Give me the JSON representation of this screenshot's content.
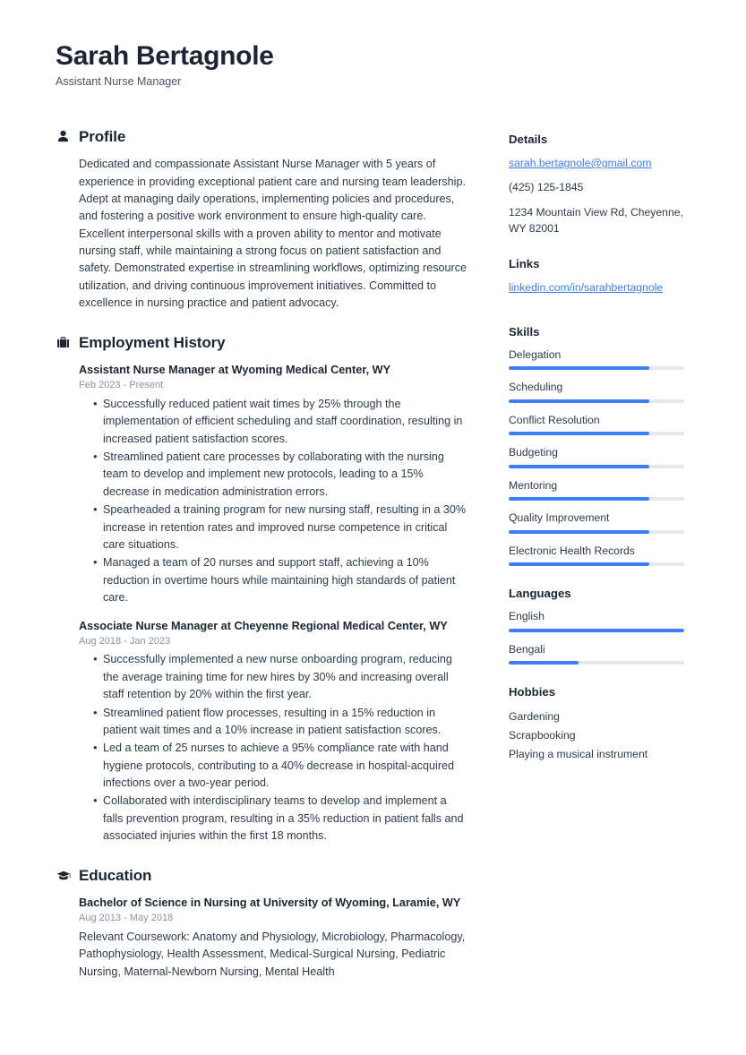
{
  "accent_color": "#3d7ef7",
  "text_color": "#2d3b4d",
  "heading_color": "#1b2533",
  "muted_color": "#8a939f",
  "track_color": "#e6e8ea",
  "header": {
    "full_name": "Sarah Bertagnole",
    "job_title": "Assistant Nurse Manager"
  },
  "sections": {
    "profile": {
      "title": "Profile",
      "icon": "person-icon",
      "text": "Dedicated and compassionate Assistant Nurse Manager with 5 years of experience in providing exceptional patient care and nursing team leadership. Adept at managing daily operations, implementing policies and procedures, and fostering a positive work environment to ensure high-quality care. Excellent interpersonal skills with a proven ability to mentor and motivate nursing staff, while maintaining a strong focus on patient satisfaction and safety. Demonstrated expertise in streamlining workflows, optimizing resource utilization, and driving continuous improvement initiatives. Committed to excellence in nursing practice and patient advocacy."
    },
    "employment": {
      "title": "Employment History",
      "icon": "briefcase-icon",
      "entries": [
        {
          "title": "Assistant Nurse Manager at Wyoming Medical Center, WY",
          "date": "Feb 2023 - Present",
          "bullets": [
            "Successfully reduced patient wait times by 25% through the implementation of efficient scheduling and staff coordination, resulting in increased patient satisfaction scores.",
            "Streamlined patient care processes by collaborating with the nursing team to develop and implement new protocols, leading to a 15% decrease in medication administration errors.",
            "Spearheaded a training program for new nursing staff, resulting in a 30% increase in retention rates and improved nurse competence in critical care situations.",
            "Managed a team of 20 nurses and support staff, achieving a 10% reduction in overtime hours while maintaining high standards of patient care."
          ]
        },
        {
          "title": "Associate Nurse Manager at Cheyenne Regional Medical Center, WY",
          "date": "Aug 2018 - Jan 2023",
          "bullets": [
            "Successfully implemented a new nurse onboarding program, reducing the average training time for new hires by 30% and increasing overall staff retention by 20% within the first year.",
            "Streamlined patient flow processes, resulting in a 15% reduction in patient wait times and a 10% increase in patient satisfaction scores.",
            "Led a team of 25 nurses to achieve a 95% compliance rate with hand hygiene protocols, contributing to a 40% decrease in hospital-acquired infections over a two-year period.",
            "Collaborated with interdisciplinary teams to develop and implement a falls prevention program, resulting in a 35% reduction in patient falls and associated injuries within the first 18 months."
          ]
        }
      ]
    },
    "education": {
      "title": "Education",
      "icon": "graduation-cap-icon",
      "entries": [
        {
          "title": "Bachelor of Science in Nursing at University of Wyoming, Laramie, WY",
          "date": "Aug 2013 - May 2018",
          "description": "Relevant Coursework: Anatomy and Physiology, Microbiology, Pharmacology, Pathophysiology, Health Assessment, Medical-Surgical Nursing, Pediatric Nursing, Maternal-Newborn Nursing, Mental Health"
        }
      ]
    }
  },
  "sidebar": {
    "details": {
      "title": "Details",
      "email": "sarah.bertagnole@gmail.com",
      "phone": "(425) 125-1845",
      "address": "1234 Mountain View Rd, Cheyenne, WY 82001"
    },
    "links": {
      "title": "Links",
      "items": [
        {
          "label": "linkedin.com/in/sarahbertagnole"
        }
      ]
    },
    "skills": {
      "title": "Skills",
      "items": [
        {
          "label": "Delegation",
          "level": 80
        },
        {
          "label": "Scheduling",
          "level": 80
        },
        {
          "label": "Conflict Resolution",
          "level": 80
        },
        {
          "label": "Budgeting",
          "level": 80
        },
        {
          "label": "Mentoring",
          "level": 80
        },
        {
          "label": "Quality Improvement",
          "level": 80
        },
        {
          "label": "Electronic Health Records",
          "level": 80
        }
      ]
    },
    "languages": {
      "title": "Languages",
      "items": [
        {
          "label": "English",
          "level": 100
        },
        {
          "label": "Bengali",
          "level": 40
        }
      ]
    },
    "hobbies": {
      "title": "Hobbies",
      "items": [
        {
          "label": "Gardening"
        },
        {
          "label": "Scrapbooking"
        },
        {
          "label": "Playing a musical instrument"
        }
      ]
    }
  }
}
